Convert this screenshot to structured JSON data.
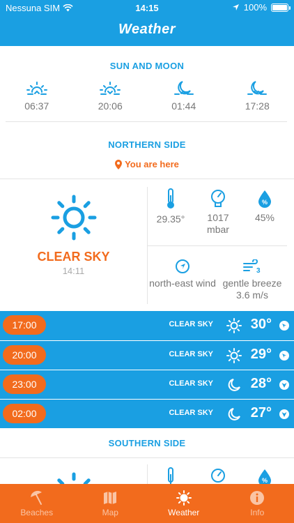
{
  "status_bar": {
    "carrier": "Nessuna SIM",
    "time": "14:15",
    "battery": "100%"
  },
  "header": {
    "title": "Weather"
  },
  "sun_moon": {
    "title": "SUN AND MOON",
    "items": [
      {
        "icon": "sunrise-icon",
        "time": "06:37"
      },
      {
        "icon": "sunset-icon",
        "time": "20:06"
      },
      {
        "icon": "moonrise-icon",
        "time": "01:44"
      },
      {
        "icon": "moonset-icon",
        "time": "17:28"
      }
    ]
  },
  "northern": {
    "title": "NORTHERN SIDE",
    "location_label": "You are here",
    "condition": "CLEAR SKY",
    "updated": "14:11",
    "temperature": "29.35°",
    "pressure_value": "1017",
    "pressure_unit": "mbar",
    "humidity": "45%",
    "wind_direction": "north-east wind",
    "wind_desc": "gentle breeze",
    "wind_speed": "3.6 m/s"
  },
  "forecast": [
    {
      "time": "17:00",
      "condition": "CLEAR SKY",
      "icon": "sun-icon",
      "temp": "30°"
    },
    {
      "time": "20:00",
      "condition": "CLEAR SKY",
      "icon": "sun-icon",
      "temp": "29°"
    },
    {
      "time": "23:00",
      "condition": "CLEAR SKY",
      "icon": "moon-icon",
      "temp": "28°"
    },
    {
      "time": "02:00",
      "condition": "CLEAR SKY",
      "icon": "moon-icon",
      "temp": "27°"
    }
  ],
  "southern": {
    "title": "SOUTHERN SIDE"
  },
  "tabs": [
    {
      "label": "Beaches",
      "icon": "beach-umbrella-icon",
      "active": false
    },
    {
      "label": "Map",
      "icon": "map-icon",
      "active": false
    },
    {
      "label": "Weather",
      "icon": "sun-icon",
      "active": true
    },
    {
      "label": "Info",
      "icon": "info-icon",
      "active": false
    }
  ],
  "colors": {
    "primary": "#1A9FE2",
    "accent": "#F26B1D"
  }
}
